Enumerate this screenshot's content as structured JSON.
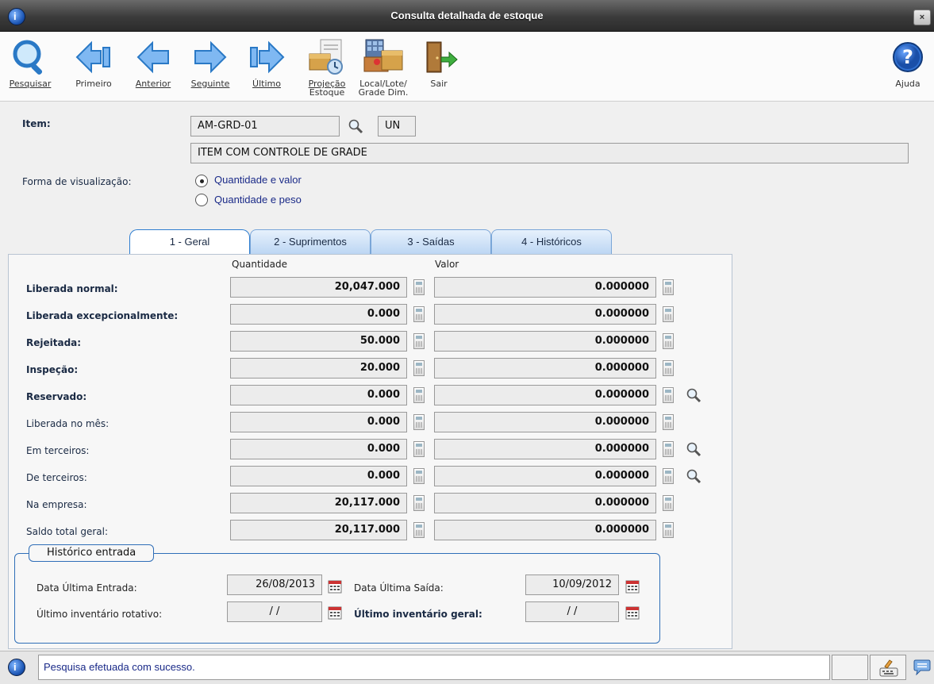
{
  "window": {
    "title": "Consulta detalhada de estoque",
    "close": "×",
    "logo": "i"
  },
  "toolbar": [
    {
      "key": "pesquisar",
      "label": "Pesquisar",
      "icon": "magnifier-icon",
      "underline": true
    },
    {
      "key": "primeiro",
      "label": "Primeiro",
      "icon": "arrow-first-icon"
    },
    {
      "key": "anterior",
      "label": "Anterior",
      "icon": "arrow-left-icon"
    },
    {
      "key": "seguinte",
      "label": "Seguinte",
      "icon": "arrow-right-icon"
    },
    {
      "key": "ultimo",
      "label": "Último",
      "icon": "arrow-last-icon"
    },
    {
      "key": "projecao",
      "label": "Projeção",
      "label2": "Estoque",
      "icon": "stock-projection-icon"
    },
    {
      "key": "local",
      "label": "Local/Lote/",
      "label2": "Grade Dim.",
      "icon": "location-lot-icon"
    },
    {
      "key": "sair",
      "label": "Sair",
      "icon": "exit-door-icon"
    },
    {
      "key": "ajuda",
      "label": "Ajuda",
      "icon": "help-icon"
    }
  ],
  "item": {
    "label": "Item:",
    "code": "AM-GRD-01",
    "unit": "UN",
    "description": "ITEM COM CONTROLE DE GRADE"
  },
  "visualizacao": {
    "label": "Forma de visualização:",
    "options": [
      {
        "label": "Quantidade e valor",
        "selected": true
      },
      {
        "label": "Quantidade e peso",
        "selected": false
      }
    ]
  },
  "tabs": [
    {
      "label": "1 - Geral",
      "active": true
    },
    {
      "label": "2 - Suprimentos",
      "active": false
    },
    {
      "label": "3 - Saídas",
      "active": false
    },
    {
      "label": "4 - Históricos",
      "active": false
    }
  ],
  "columns": {
    "quantidade": "Quantidade",
    "valor": "Valor"
  },
  "rows": [
    {
      "label": "Liberada normal:",
      "bold": true,
      "quantidade": "20,047.000",
      "valor": "0.000000",
      "search": false
    },
    {
      "label": "Liberada excepcionalmente:",
      "bold": true,
      "quantidade": "0.000",
      "valor": "0.000000",
      "search": false
    },
    {
      "label": "Rejeitada:",
      "bold": true,
      "quantidade": "50.000",
      "valor": "0.000000",
      "search": false
    },
    {
      "label": "Inspeção:",
      "bold": true,
      "quantidade": "20.000",
      "valor": "0.000000",
      "search": false
    },
    {
      "label": "Reservado:",
      "bold": true,
      "quantidade": "0.000",
      "valor": "0.000000",
      "search": true
    },
    {
      "label": "Liberada no mês:",
      "bold": false,
      "quantidade": "0.000",
      "valor": "0.000000",
      "search": false
    },
    {
      "label": "Em terceiros:",
      "bold": false,
      "quantidade": "0.000",
      "valor": "0.000000",
      "search": true
    },
    {
      "label": "De terceiros:",
      "bold": false,
      "quantidade": "0.000",
      "valor": "0.000000",
      "search": true
    },
    {
      "label": "Na empresa:",
      "bold": false,
      "quantidade": "20,117.000",
      "valor": "0.000000",
      "search": false
    },
    {
      "label": "Saldo total geral:",
      "bold": false,
      "quantidade": "20,117.000",
      "valor": "0.000000",
      "search": false
    }
  ],
  "historico": {
    "legend": "Histórico entrada",
    "ultima_entrada_label": "Data Última Entrada:",
    "ultima_entrada": "26/08/2013",
    "ultima_saida_label": "Data Última Saída:",
    "ultima_saida": "10/09/2012",
    "inv_rotativo_label": "Último inventário rotativo:",
    "inv_rotativo": "/ /",
    "inv_geral_label": "Último inventário geral:",
    "inv_geral": "/ /"
  },
  "status": {
    "message": "Pesquisa efetuada com sucesso."
  },
  "colors": {
    "accent": "#2f7ed0",
    "label": "#1a2a44",
    "status_text": "#1a2a88"
  }
}
